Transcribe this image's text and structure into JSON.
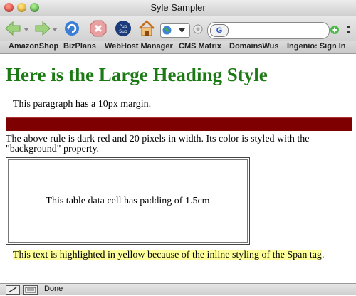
{
  "window": {
    "title": "Syle Sampler"
  },
  "toolbar": {
    "icons": [
      "back-arrow-icon",
      "forward-arrow-icon",
      "reload-icon",
      "stop-icon",
      "pubsub-icon",
      "home-icon",
      "globe-icon",
      "add-icon"
    ],
    "search_engine_glyph": "G"
  },
  "bookmarks": [
    "AmazonShop",
    "BizPlans",
    "WebHost Manager",
    "CMS Matrix",
    "DomainsWus",
    "Ingenio: Sign In"
  ],
  "content": {
    "heading": "Here is the Large Heading Style",
    "paragraph_margin": "This paragraph has a 10px margin.",
    "rule_description": "The above rule is dark red and 20 pixels in width. Its color is styled with the \"background\" property.",
    "table_cell_text": "This table data cell has padding of 1.5cm",
    "highlighted_text": "This text is highlighted in yellow because of the inline styling of the Span tag",
    "highlighted_suffix": ".",
    "colors": {
      "heading": "#1c7a14",
      "rule": "#7f0000",
      "highlight": "#ffff99"
    }
  },
  "status": {
    "text": "Done"
  }
}
